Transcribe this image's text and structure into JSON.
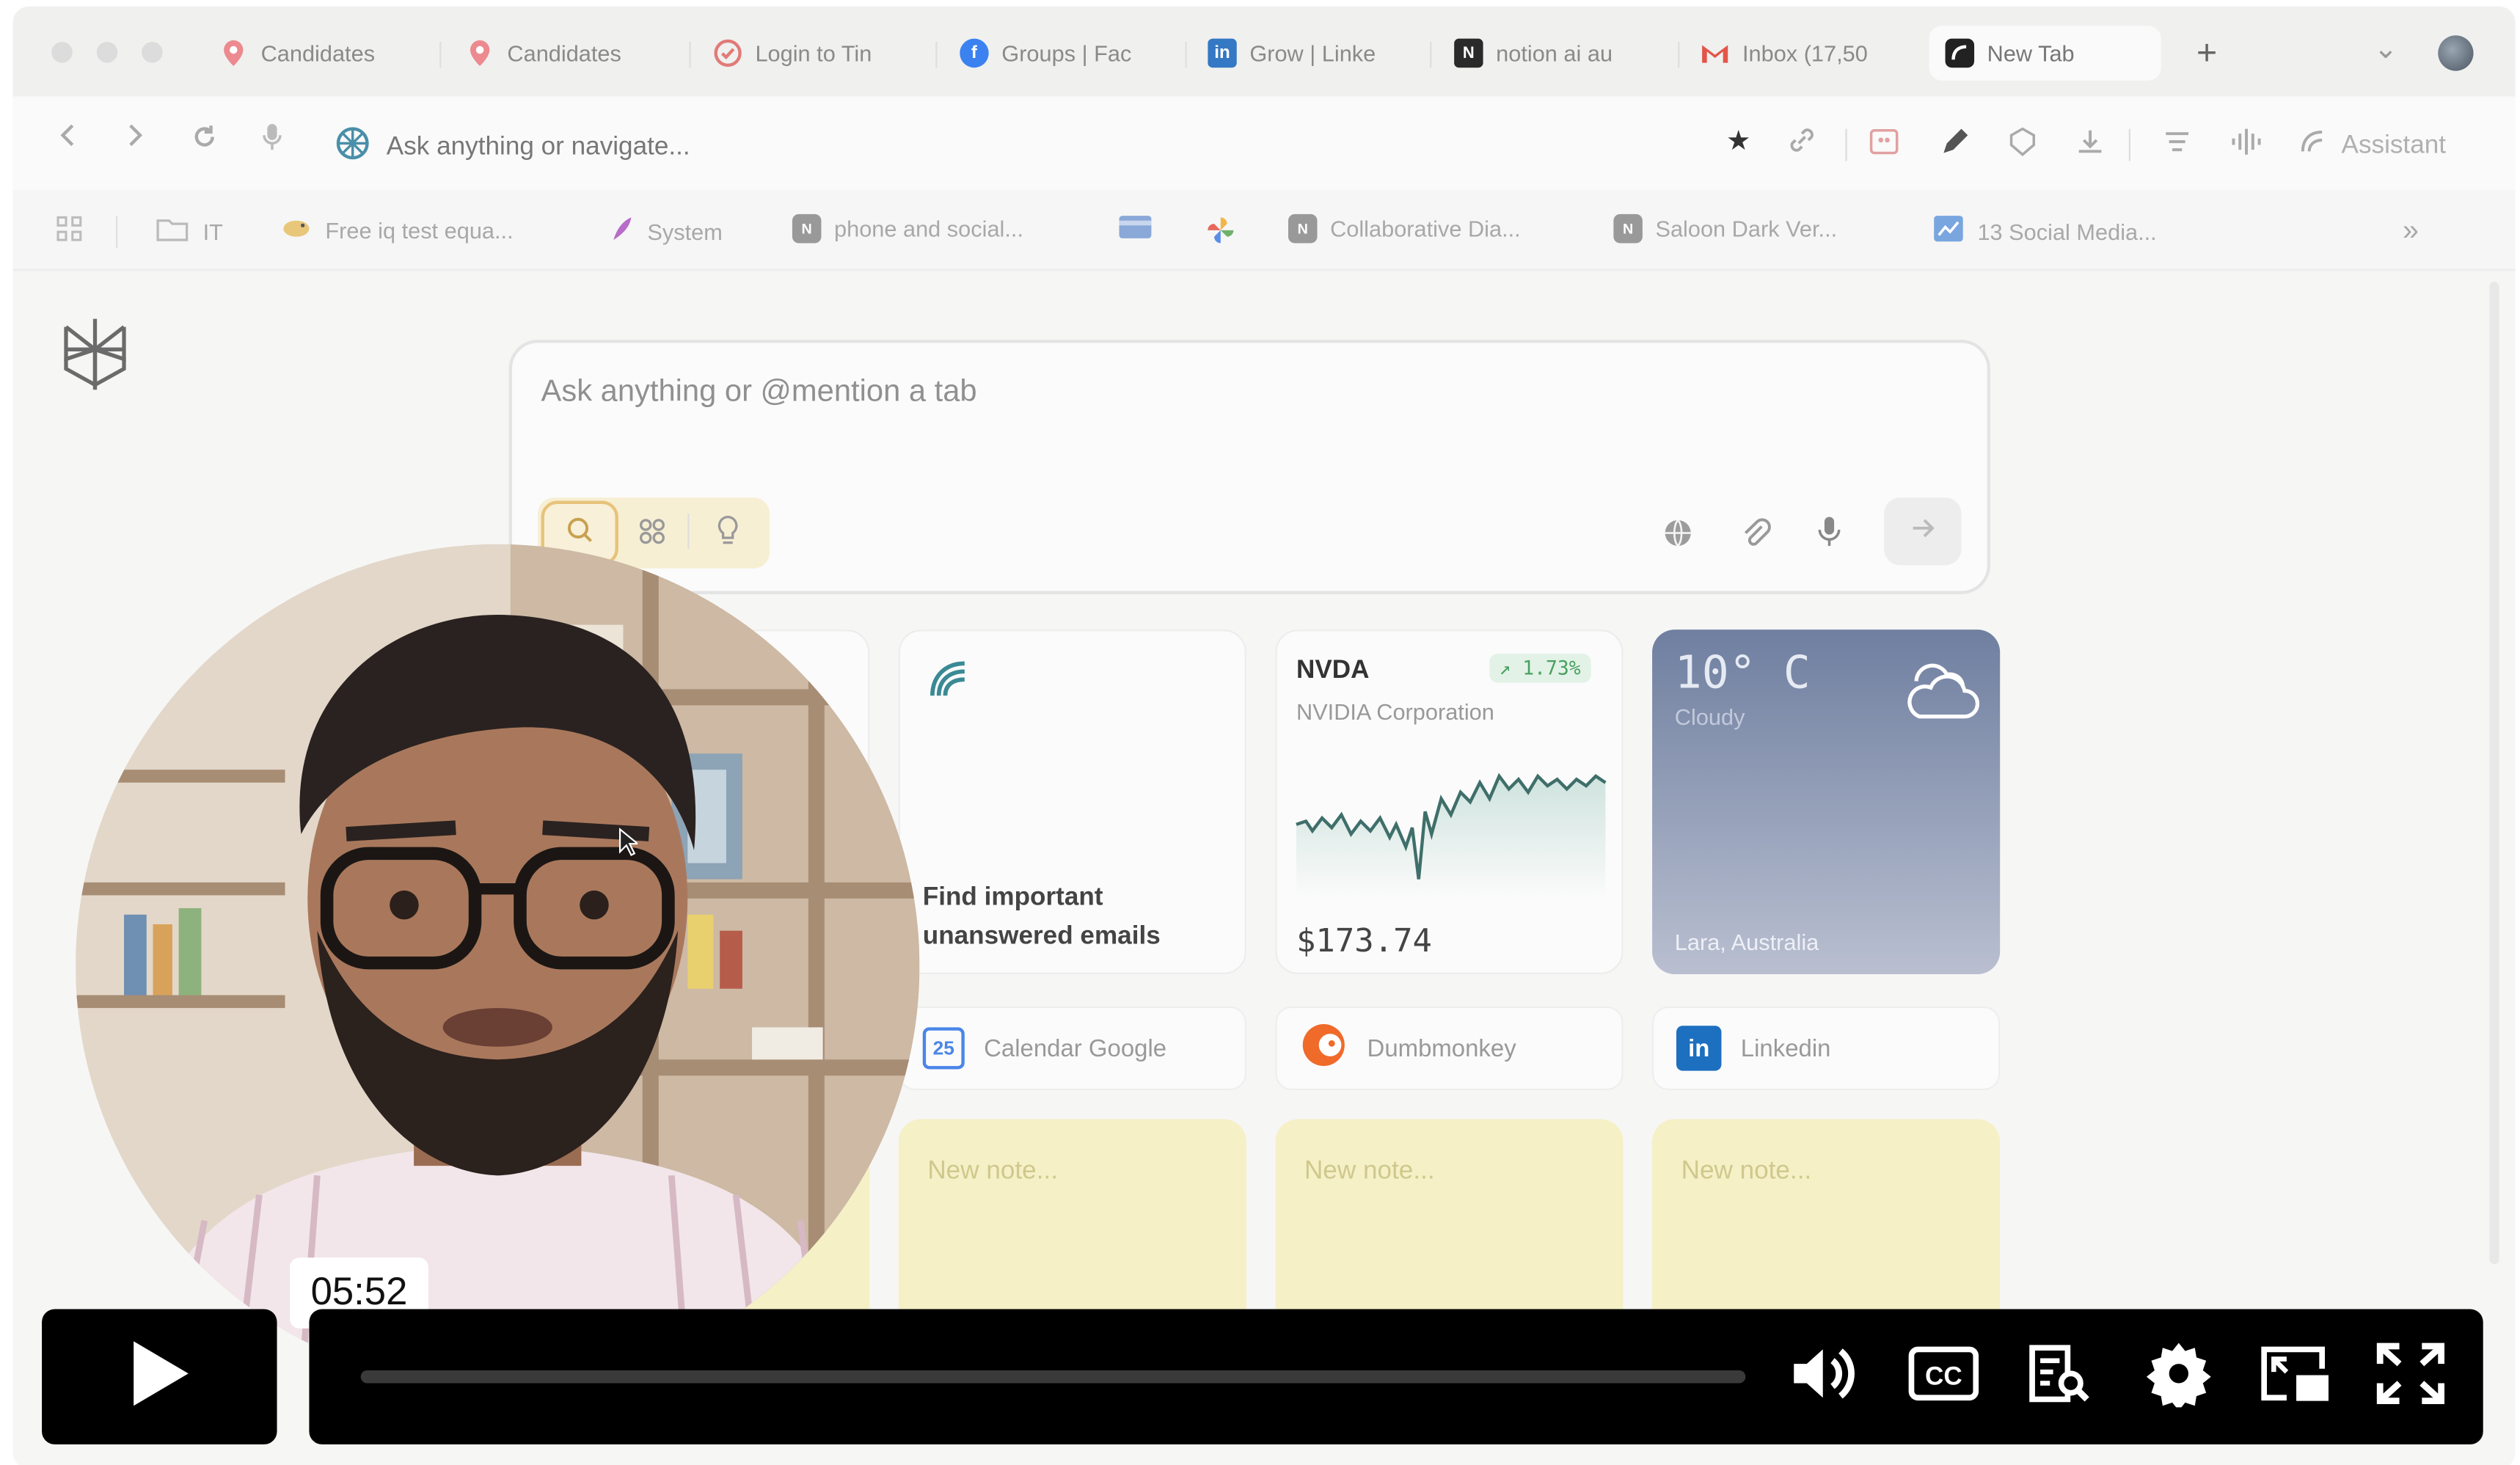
{
  "browser": {
    "tabs": [
      {
        "label": "Candidates",
        "icon": "pin-icon",
        "color": "#e46d73"
      },
      {
        "label": "Candidates",
        "icon": "pin-icon",
        "color": "#e46d73"
      },
      {
        "label": "Login to Tin",
        "icon": "check-circle-icon",
        "color": "#d9534f"
      },
      {
        "label": "Groups | Fac",
        "icon": "facebook-icon",
        "color": "#1877f2"
      },
      {
        "label": "Grow | Linke",
        "icon": "linkedin-icon",
        "color": "#0a66c2"
      },
      {
        "label": "notion ai au",
        "icon": "notion-icon",
        "color": "#222222"
      },
      {
        "label": "Inbox (17,50",
        "icon": "gmail-icon",
        "color": "#ea4335"
      },
      {
        "label": "New Tab",
        "icon": "arc-icon",
        "color": "#222222",
        "active": true
      }
    ],
    "new_tab_symbol": "+",
    "tab_menu_symbol": "⌄",
    "address_placeholder": "Ask anything or navigate...",
    "assistant_label": "Assistant",
    "bookmarks": [
      {
        "label": "",
        "icon": "apps-grid-icon"
      },
      {
        "label": "IT",
        "icon": "folder-icon"
      },
      {
        "label": "Free iq test equa...",
        "icon": "bird-icon"
      },
      {
        "label": "System",
        "icon": "feather-icon"
      },
      {
        "label": "phone and social...",
        "icon": "notion-small-icon"
      },
      {
        "label": "",
        "icon": "card-icon"
      },
      {
        "label": "",
        "icon": "pinwheel-icon"
      },
      {
        "label": "Collaborative Dia...",
        "icon": "notion-small-icon"
      },
      {
        "label": "Saloon Dark Ver...",
        "icon": "notion-small-icon"
      },
      {
        "label": "13 Social Media...",
        "icon": "chart-bookmark-icon"
      }
    ],
    "bookmarks_more": "»"
  },
  "newtab": {
    "prompt_placeholder": "Ask anything or @mention a tab",
    "email_card_text": "Find important unanswered emails",
    "stock": {
      "ticker": "NVDA",
      "company": "NVIDIA Corporation",
      "change": "↗ 1.73%",
      "price": "$173.74"
    },
    "weather": {
      "temp": "10° C",
      "condition": "Cloudy",
      "location": "Lara, Australia"
    },
    "links": [
      {
        "label": "Calendar Google",
        "icon": "google-calendar-icon"
      },
      {
        "label": "Dumbmonkey",
        "icon": "dumbmonkey-icon"
      },
      {
        "label": "Linkedin",
        "icon": "linkedin-icon"
      }
    ],
    "notes": [
      "New note...",
      "New note...",
      "New note..."
    ]
  },
  "video": {
    "time_tooltip": "05:52",
    "progress": 0.0
  },
  "colors": {
    "weather_top": "#6f7fa0",
    "weather_bottom": "#b9bfd0",
    "note_bg": "#f5f0c6",
    "controls_bg": "#000000",
    "stock_line": "#3f6f6a"
  }
}
